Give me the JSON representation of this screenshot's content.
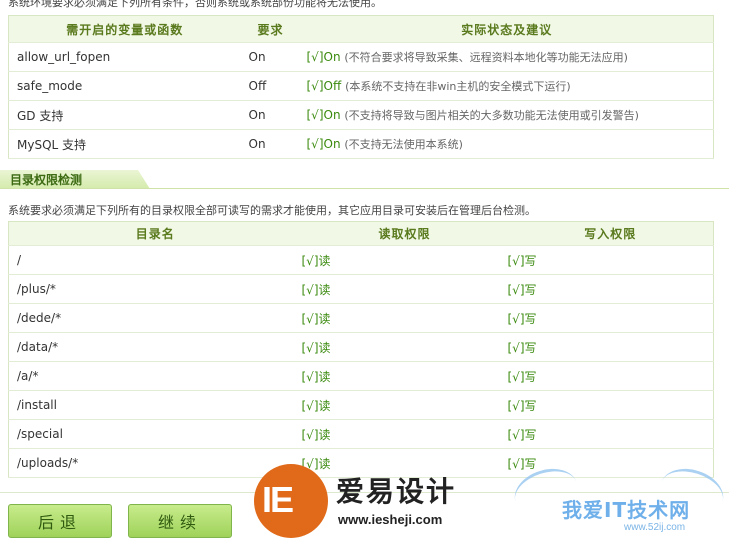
{
  "top_note": "系统环境要求必须满足下列所有条件，否则系统或系统部份功能将无法使用。",
  "env_table": {
    "headers": [
      "需开启的变量或函数",
      "要求",
      "实际状态及建议"
    ],
    "rows": [
      {
        "name": "allow_url_fopen",
        "req": "On",
        "status": "[√]On",
        "note": "(不符合要求将导致采集、远程资料本地化等功能无法应用)"
      },
      {
        "name": "safe_mode",
        "req": "Off",
        "status": "[√]Off",
        "note": "(本系统不支持在非win主机的安全模式下运行)"
      },
      {
        "name": "GD 支持",
        "req": "On",
        "status": "[√]On",
        "note": "(不支持将导致与图片相关的大多数功能无法使用或引发警告)"
      },
      {
        "name": "MySQL 支持",
        "req": "On",
        "status": "[√]On",
        "note": "(不支持无法使用本系统)"
      }
    ]
  },
  "section": {
    "title": "目录权限检测"
  },
  "dir_note": "系统要求必须满足下列所有的目录权限全部可读写的需求才能使用，其它应用目录可安装后在管理后台检测。",
  "dir_table": {
    "headers": [
      "目录名",
      "读取权限",
      "写入权限"
    ],
    "rows": [
      {
        "dir": "/",
        "read": "[√]读",
        "write": "[√]写"
      },
      {
        "dir": "/plus/*",
        "read": "[√]读",
        "write": "[√]写"
      },
      {
        "dir": "/dede/*",
        "read": "[√]读",
        "write": "[√]写"
      },
      {
        "dir": "/data/*",
        "read": "[√]读",
        "write": "[√]写"
      },
      {
        "dir": "/a/*",
        "read": "[√]读",
        "write": "[√]写"
      },
      {
        "dir": "/install",
        "read": "[√]读",
        "write": "[√]写"
      },
      {
        "dir": "/special",
        "read": "[√]读",
        "write": "[√]写"
      },
      {
        "dir": "/uploads/*",
        "read": "[√]读",
        "write": "[√]写"
      }
    ]
  },
  "buttons": {
    "back": "后退",
    "next": "继续"
  },
  "watermark1": {
    "letters": "IE",
    "title": "爱易设计",
    "url": "www.iesheji.com"
  },
  "watermark2": {
    "title": "我爱IT技术网",
    "url": "www.52ij.com"
  },
  "colors": {
    "accent_green": "#3a8a0e",
    "header_bg": "#f2f8e6",
    "button_green": "#9fd25a"
  }
}
